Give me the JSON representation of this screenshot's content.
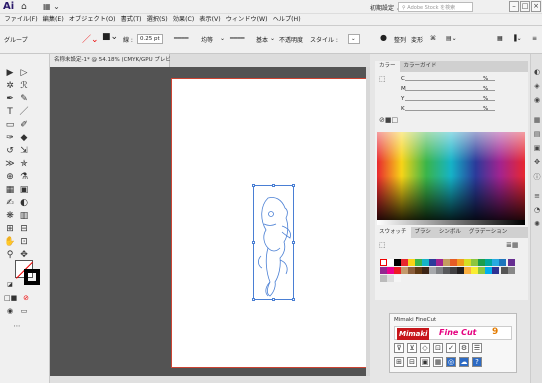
{
  "app": {
    "logo": "Ai",
    "workspace_label": "初期設定 ⌄",
    "stock_search_placeholder": "Adobe Stock を検索"
  },
  "menu": [
    "ファイル(F)",
    "編集(E)",
    "オブジェクト(O)",
    "書式(T)",
    "選択(S)",
    "効果(C)",
    "表示(V)",
    "ウィンドウ(W)",
    "ヘルプ(H)"
  ],
  "control": {
    "selection_label": "グループ",
    "stroke_label": "線 :",
    "stroke_weight": "0.25 pt",
    "profile_1": "均等",
    "profile_2": "基本",
    "opacity_label": "不透明度",
    "style_label": "スタイル :",
    "align_label": "整列",
    "transform_label": "変形"
  },
  "document": {
    "tab_label": "名称未設定-1* @ 54.18% (CMYK/GPU プレビュー)"
  },
  "color_panel": {
    "tabs": [
      "カラー",
      "カラーガイド"
    ],
    "channels": [
      "C",
      "M",
      "Y",
      "K"
    ],
    "unit": "%"
  },
  "swatches_panel": {
    "tabs": [
      "スウォッチ",
      "ブラシ",
      "シンボル",
      "グラデーション"
    ]
  },
  "plugin": {
    "title": "Mimaki FineCut",
    "brand": "Mimaki",
    "product": "Fine Cut",
    "version": "9"
  },
  "colors": {
    "accent": "#4a7fd4",
    "artboard_border": "#cc3333",
    "mimaki_red": "#c7151a"
  }
}
